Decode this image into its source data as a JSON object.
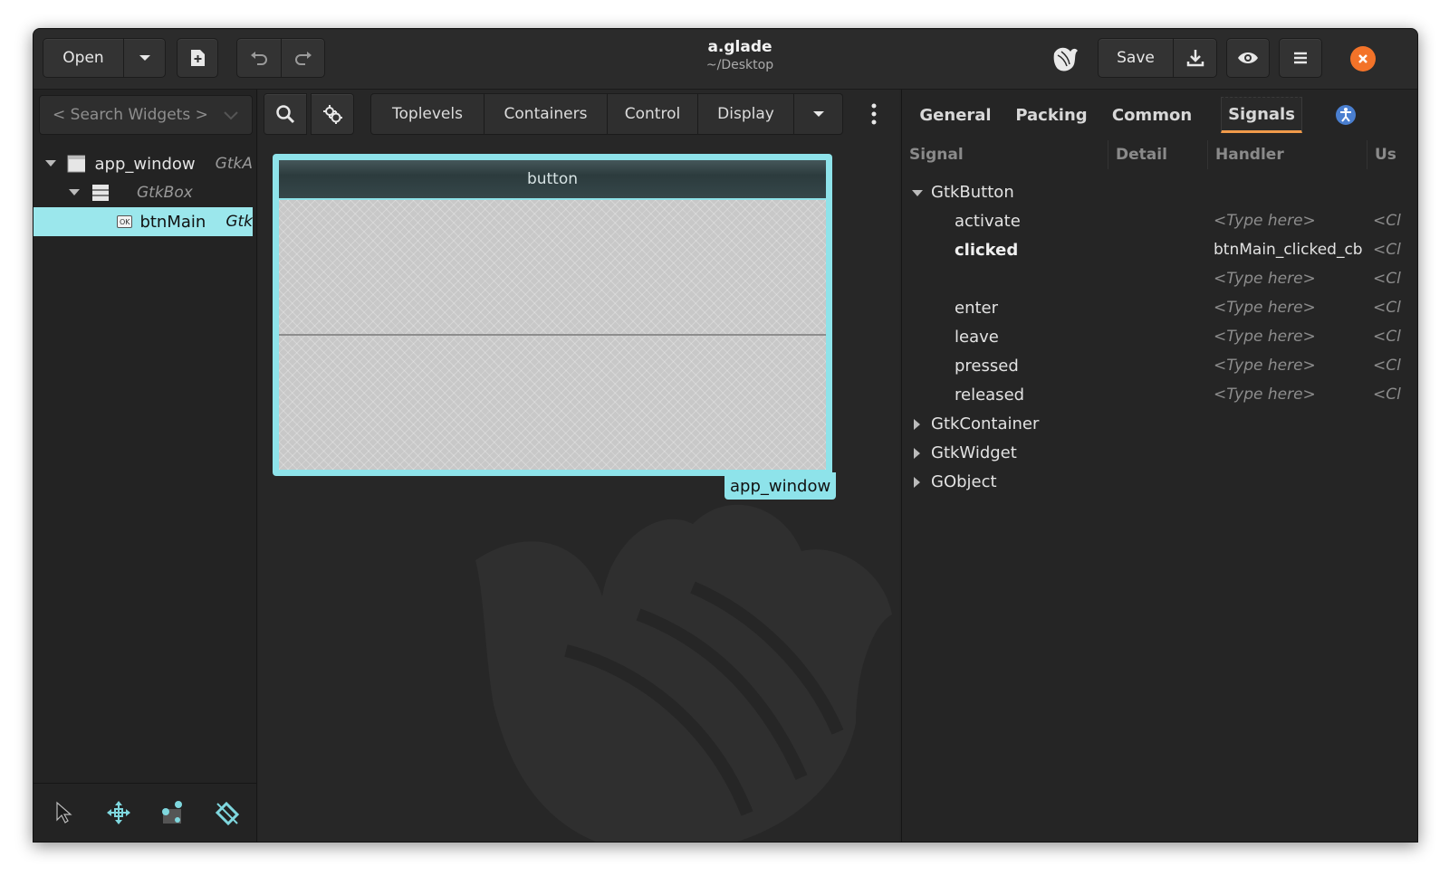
{
  "header": {
    "open_label": "Open",
    "title": "a.glade",
    "subtitle": "~/Desktop",
    "save_label": "Save"
  },
  "left": {
    "search_placeholder": "< Search Widgets >",
    "tree": [
      {
        "name": "app_window",
        "type": "GtkA"
      },
      {
        "name": "",
        "type": "GtkBox"
      },
      {
        "name": "btnMain",
        "type": "Gtk",
        "badge": "OK"
      }
    ]
  },
  "palette": {
    "tabs": [
      "Toplevels",
      "Containers",
      "Control",
      "Display"
    ]
  },
  "canvas": {
    "button_label": "button",
    "window_label": "app_window"
  },
  "right": {
    "tabs": [
      "General",
      "Packing",
      "Common",
      "Signals"
    ],
    "active_tab": "Signals",
    "columns": [
      "Signal",
      "Detail",
      "Handler",
      "Us"
    ],
    "groups": {
      "gtkbutton": "GtkButton",
      "gtkcontainer": "GtkContainer",
      "gtkwidget": "GtkWidget",
      "gobject": "GObject"
    },
    "signals": [
      {
        "signal": "activate",
        "handler": "<Type here>",
        "user": "<Cl"
      },
      {
        "signal": "clicked",
        "handler": "btnMain_clicked_cb",
        "user": "<Cl"
      },
      {
        "signal": "",
        "handler": "<Type here>",
        "user": "<Cl"
      },
      {
        "signal": "enter",
        "handler": "<Type here>",
        "user": "<Cl"
      },
      {
        "signal": "leave",
        "handler": "<Type here>",
        "user": "<Cl"
      },
      {
        "signal": "pressed",
        "handler": "<Type here>",
        "user": "<Cl"
      },
      {
        "signal": "released",
        "handler": "<Type here>",
        "user": "<Cl"
      }
    ]
  },
  "colors": {
    "accent": "#8ee3ea",
    "close": "#f37329",
    "tab_underline": "#f09a4a"
  }
}
